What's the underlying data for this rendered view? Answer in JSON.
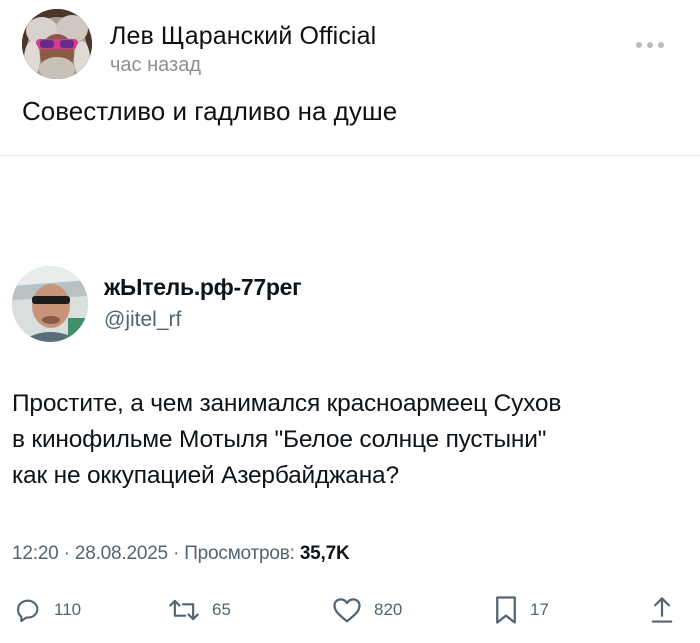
{
  "post": {
    "author": "Лев Щаранский Official",
    "time": "час назад",
    "text": "Совестливо и гадливо на душе"
  },
  "tweet": {
    "display_name": "жЫтель.рф-77рег",
    "handle": "@jitel_rf",
    "text_lines": [
      "Простите, а чем занимался красноармеец Сухов",
      "в кинофильме Мотыля \"Белое солнце пустыни\"",
      "как не оккупацией Азербайджана?"
    ],
    "meta_prefix": "12:20 · 28.08.2025 · Просмотров: ",
    "views": "35,7K",
    "actions": {
      "replies": "110",
      "retweets": "65",
      "likes": "820",
      "bookmarks": "17"
    }
  },
  "icons": {
    "more": "more-dots-icon",
    "reply": "reply-icon",
    "retweet": "retweet-icon",
    "like": "heart-icon",
    "bookmark": "bookmark-icon",
    "share": "share-icon"
  },
  "colors": {
    "secondary_text": "#536471",
    "primary_text": "#0f1419",
    "time_text": "#8b8f94"
  }
}
